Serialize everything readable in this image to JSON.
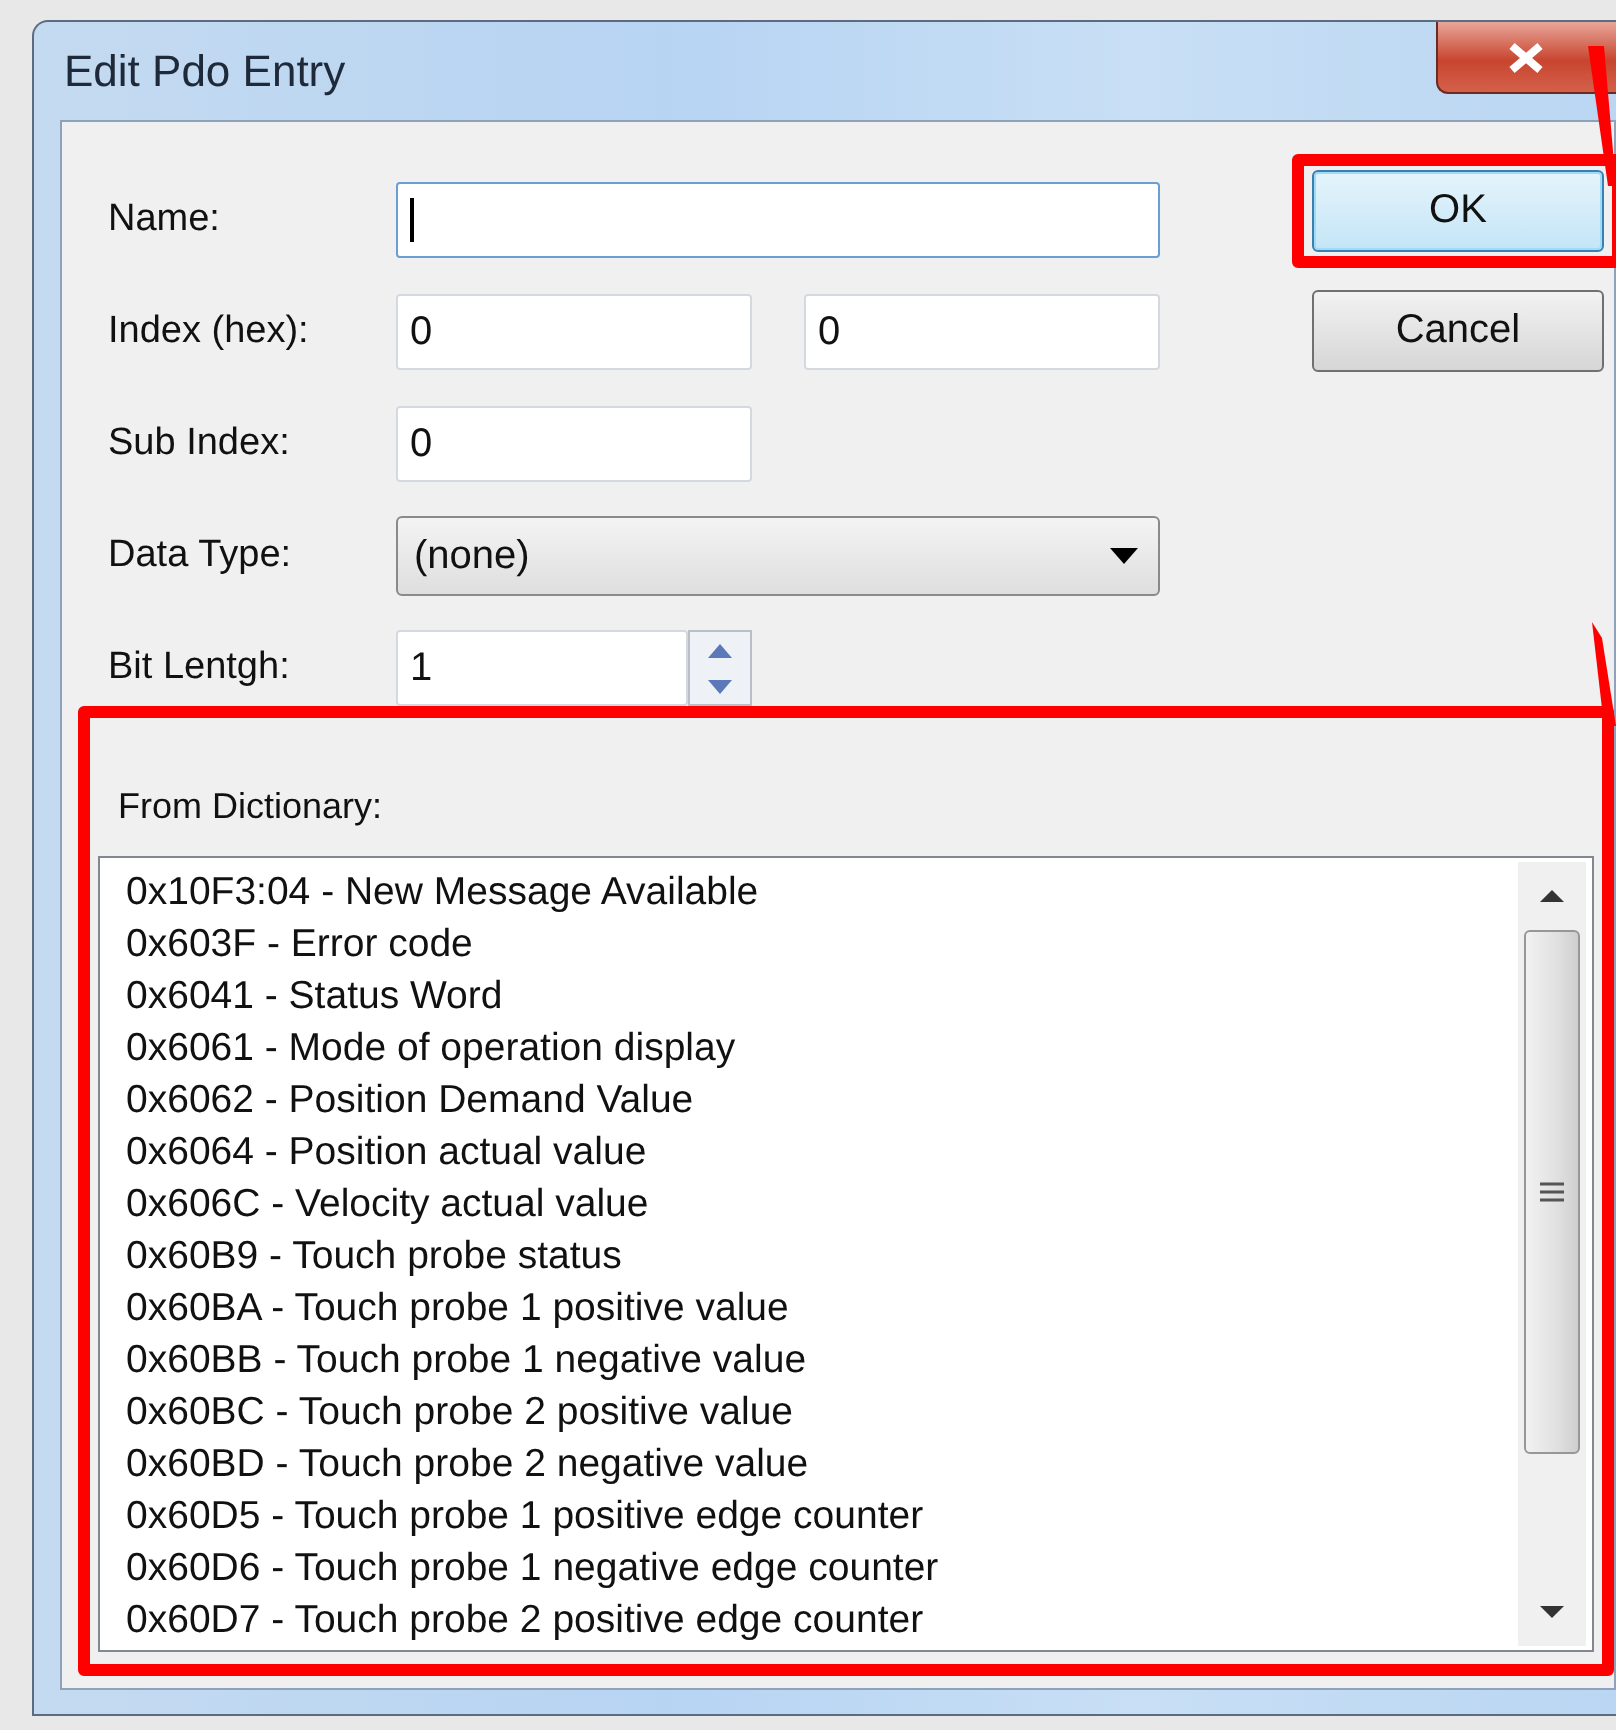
{
  "window": {
    "title": "Edit Pdo Entry"
  },
  "fields": [
    {
      "kind": "text",
      "label": "Name:",
      "focused": true
    },
    {
      "kind": "pair",
      "label": "Index (hex):",
      "values": [
        "0",
        "0"
      ],
      "focused": false
    },
    {
      "kind": "text",
      "label": "Sub Index:",
      "values": [
        "0"
      ],
      "focused": false
    },
    {
      "kind": "combo",
      "label": "Data Type:",
      "values": [
        "(none)"
      ],
      "focused": false
    },
    {
      "kind": "spin",
      "label": "Bit Lentgh:",
      "values": [
        "1"
      ],
      "focused": false
    }
  ],
  "buttons": [
    {
      "label": "OK",
      "highlighted": true
    },
    {
      "label": "Cancel",
      "highlighted": false
    }
  ],
  "dictionary": {
    "label": "From Dictionary:",
    "highlighted": true,
    "items": [
      "0x10F3:04 - New Message Available",
      "0x603F - Error code",
      "0x6041 - Status Word",
      "0x6061 - Mode of operation display",
      "0x6062 - Position Demand Value",
      "0x6064 - Position actual value",
      "0x606C - Velocity actual value",
      "0x60B9 - Touch probe status",
      "0x60BA - Touch probe 1 positive value",
      "0x60BB - Touch probe 1 negative value",
      "0x60BC - Touch probe 2 positive value",
      "0x60BD - Touch probe 2 negative value",
      "0x60D5 - Touch probe 1 positive edge counter",
      "0x60D6 - Touch probe 1 negative edge counter",
      "0x60D7 - Touch probe 2 positive edge counter"
    ]
  }
}
